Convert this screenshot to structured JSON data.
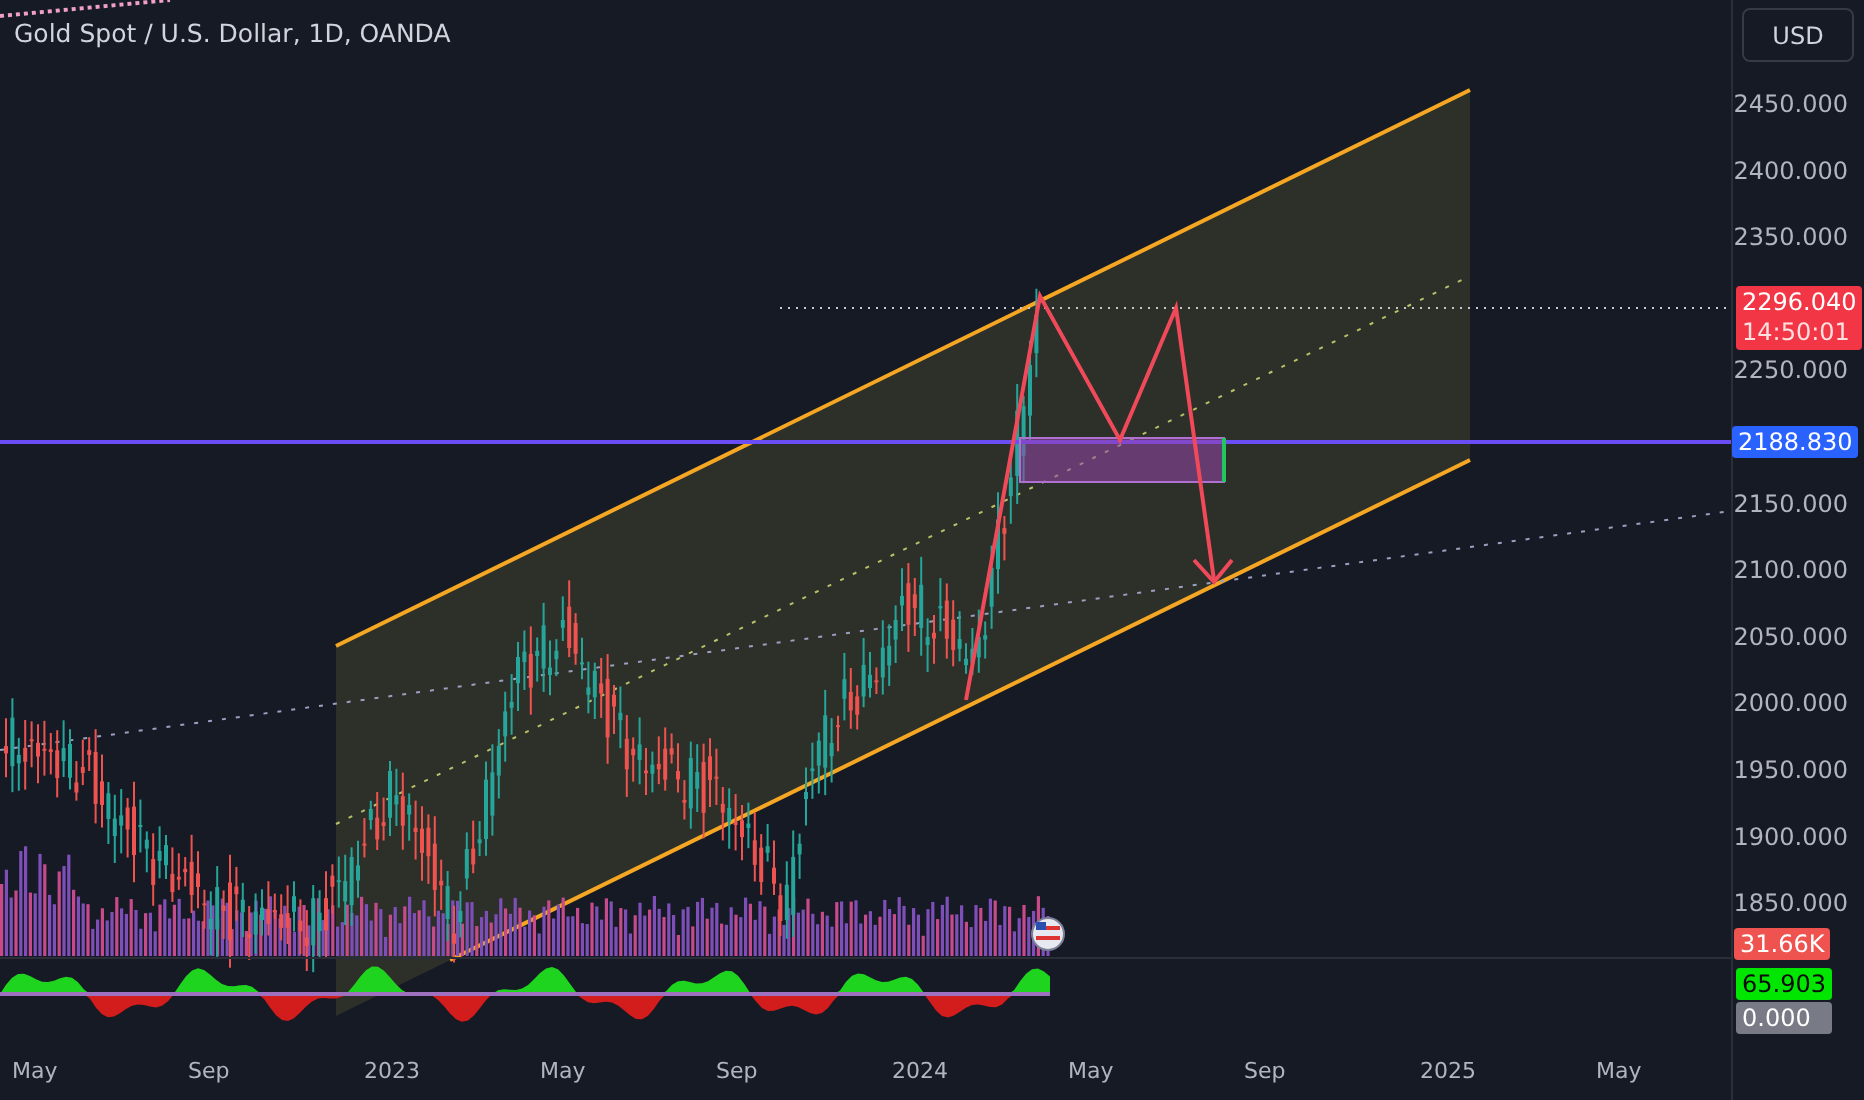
{
  "chart": {
    "title": "Gold Spot / U.S. Dollar, 1D, OANDA"
  },
  "currency_button": "USD",
  "price_axis": [
    "2450.000",
    "2400.000",
    "2350.000",
    "2250.000",
    "2150.000",
    "2100.000",
    "2050.000",
    "2000.000",
    "1950.000",
    "1900.000",
    "1850.000"
  ],
  "last_price": {
    "value": "2296.040",
    "countdown": "14:50:01"
  },
  "level_line": {
    "value": "2188.830"
  },
  "volume_badge": "31.66K",
  "oscillator_badges": [
    {
      "text": "65.903",
      "color": "#00e600"
    },
    {
      "text": "0.000",
      "color": "#787b86"
    }
  ],
  "time_axis": [
    "May",
    "Sep",
    "2023",
    "May",
    "Sep",
    "2024",
    "May",
    "Sep",
    "2025",
    "May"
  ]
}
